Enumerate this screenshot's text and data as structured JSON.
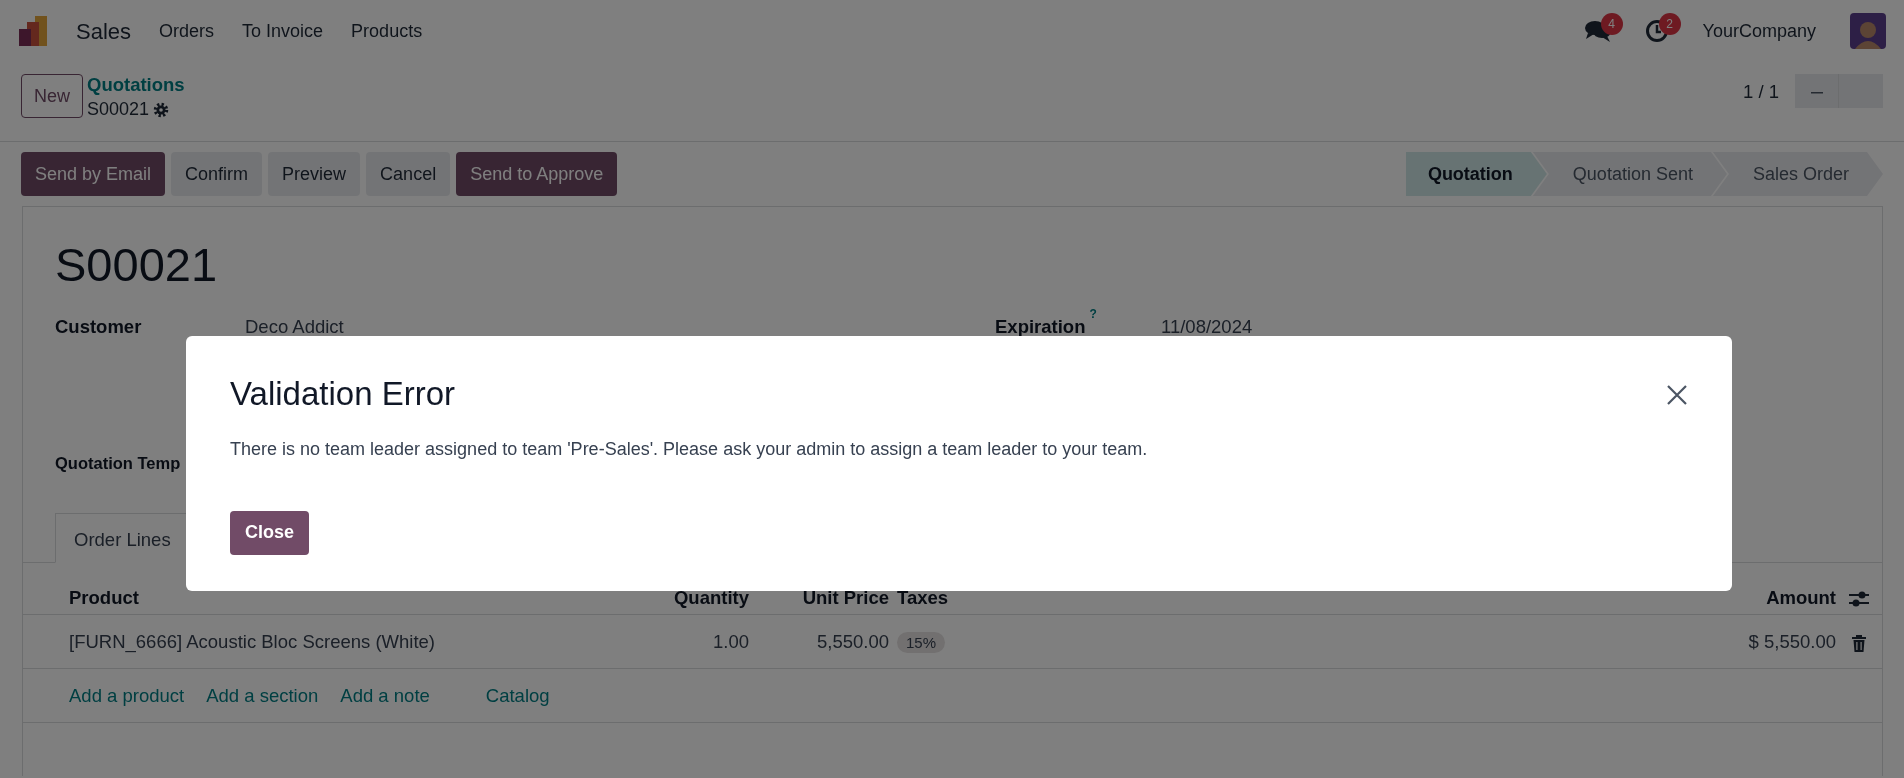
{
  "navbar": {
    "app": "Sales",
    "menu": [
      {
        "label": "Orders"
      },
      {
        "label": "To Invoice"
      },
      {
        "label": "Products"
      }
    ],
    "messages_count": "4",
    "activities_count": "2",
    "company": "YourCompany"
  },
  "control_panel": {
    "new_button": "New",
    "breadcrumb": "Quotations",
    "record": "S00021",
    "pager": "1 / 1"
  },
  "actions": [
    {
      "label": "Send by Email",
      "kind": "primary"
    },
    {
      "label": "Confirm",
      "kind": "secondary"
    },
    {
      "label": "Preview",
      "kind": "secondary"
    },
    {
      "label": "Cancel",
      "kind": "secondary"
    },
    {
      "label": "Send to Approve",
      "kind": "primary"
    }
  ],
  "statusbar": [
    {
      "label": "Quotation",
      "selected": true
    },
    {
      "label": "Quotation Sent",
      "selected": false
    },
    {
      "label": "Sales Order",
      "selected": false
    }
  ],
  "form": {
    "title": "S00021",
    "fields": [
      {
        "label": "Customer",
        "value": "Deco Addict"
      },
      {
        "label": "Expiration",
        "help": "?",
        "value": "11/08/2024"
      }
    ],
    "template_label": "Quotation Temp"
  },
  "tabs": [
    {
      "label": "Order Lines",
      "selected": true
    }
  ],
  "order_lines": {
    "columns": [
      "Product",
      "Quantity",
      "Unit Price",
      "Taxes",
      "Amount"
    ],
    "rows": [
      {
        "product": "[FURN_6666] Acoustic Bloc Screens (White)",
        "quantity": "1.00",
        "unit_price": "5,550.00",
        "taxes": "15%",
        "amount": "$ 5,550.00"
      }
    ],
    "add_links": [
      "Add a product",
      "Add a section",
      "Add a note",
      "Catalog"
    ]
  },
  "dialog": {
    "title": "Validation Error",
    "message": "There is no team leader assigned to team 'Pre-Sales'. Please ask your admin to assign a team leader to your team.",
    "buttons": [
      "Close"
    ]
  }
}
